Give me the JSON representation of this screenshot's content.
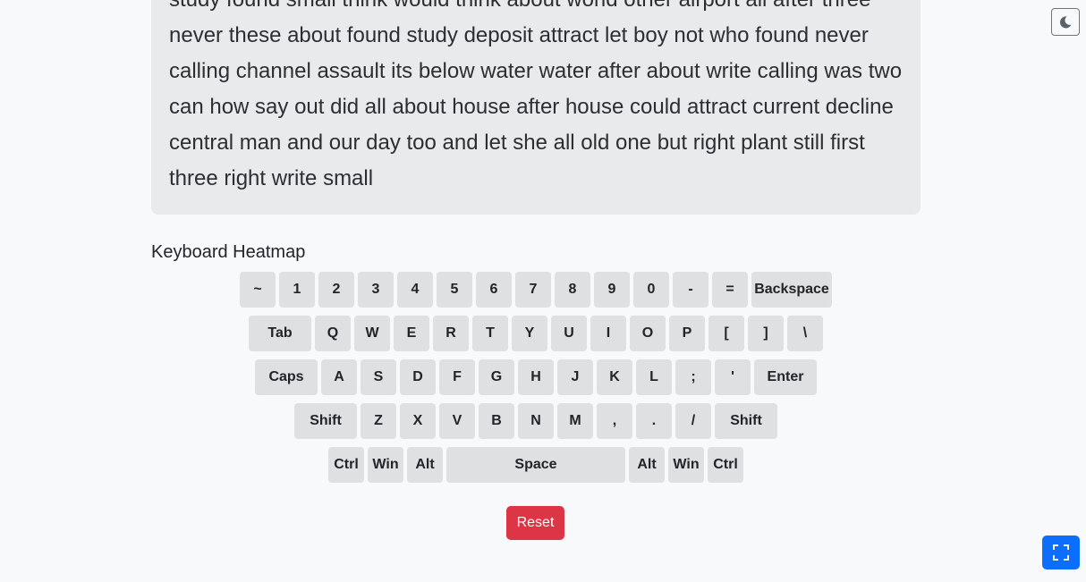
{
  "text_panel": {
    "lines": [
      "study found small think would think about world other airport all after three",
      "never these about found study deposit attract let boy not who found never",
      "calling channel assault its below water water after about write calling was two",
      "can how say out did all about house after house could attract current decline",
      "central man and our day too and let she all old one but right plant still first",
      "three right write small"
    ]
  },
  "theme_toggle": {
    "icon": "moon-icon"
  },
  "heatmap": {
    "title": "Keyboard Heatmap",
    "rows": [
      [
        "~",
        "1",
        "2",
        "3",
        "4",
        "5",
        "6",
        "7",
        "8",
        "9",
        "0",
        "-",
        "=",
        "Backspace"
      ],
      [
        "Tab",
        "Q",
        "W",
        "E",
        "R",
        "T",
        "Y",
        "U",
        "I",
        "O",
        "P",
        "[",
        "]",
        "\\"
      ],
      [
        "Caps",
        "A",
        "S",
        "D",
        "F",
        "G",
        "H",
        "J",
        "K",
        "L",
        ";",
        "'",
        "Enter"
      ],
      [
        "Shift",
        "Z",
        "X",
        "V",
        "B",
        "N",
        "M",
        ",",
        ".",
        "/",
        "Shift"
      ],
      [
        "Ctrl",
        "Win",
        "Alt",
        "Space",
        "Alt",
        "Win",
        "Ctrl"
      ]
    ]
  },
  "reset": {
    "label": "Reset",
    "color": "#dc3545"
  },
  "fullscreen": {
    "icon": "fullscreen-icon",
    "color": "#0d6efd"
  }
}
